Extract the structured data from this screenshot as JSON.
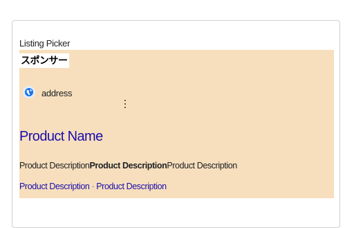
{
  "picker": {
    "title": "Listing Picker"
  },
  "ad": {
    "sponsor_label": "スポンサー",
    "address": "address",
    "icon": "globe-icon",
    "product_name": "Product Name",
    "description": {
      "part1": "Product Description",
      "part2_bold": "Product Description",
      "part3": "Product Description"
    },
    "links": {
      "link1": "Product Description",
      "separator": "·",
      "link2": "Product Description"
    }
  },
  "colors": {
    "panel_background": "#f7dfbd",
    "link": "#1a0dab",
    "icon_blue": "#1a73e8"
  }
}
